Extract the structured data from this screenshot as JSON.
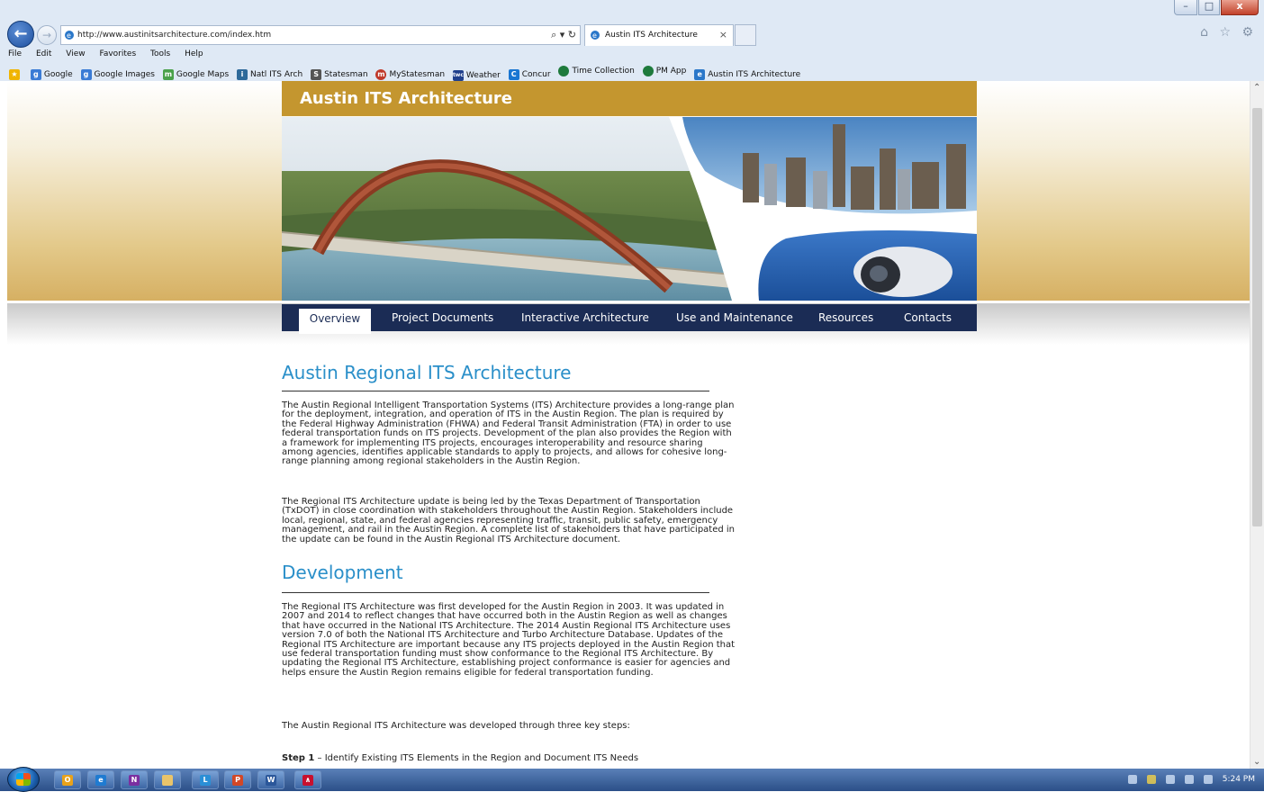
{
  "browser": {
    "address": "http://www.austinitsarchitecture.com/index.htm",
    "tab_title": "Austin ITS Architecture",
    "tab_close": "×",
    "search_tools": "⌕ ▾ ↻",
    "right_icons": "⌂ ☆ ⚙",
    "window_buttons": {
      "minimize": "–",
      "maximize": "□",
      "close": "x"
    },
    "menu": [
      "File",
      "Edit",
      "View",
      "Favorites",
      "Tools",
      "Help"
    ],
    "favorites": [
      {
        "label": "Google",
        "icon": "google-icon",
        "color": "#3a7bd5"
      },
      {
        "label": "Google Images",
        "icon": "google-icon",
        "color": "#3a7bd5"
      },
      {
        "label": "Google Maps",
        "icon": "maps-icon",
        "color": "#4aa14a"
      },
      {
        "label": "Natl ITS Arch",
        "icon": "its-icon",
        "color": "#2e6a9a"
      },
      {
        "label": "Statesman",
        "icon": "newspaper-icon",
        "color": "#555555"
      },
      {
        "label": "MyStatesman",
        "icon": "mystatesman-icon",
        "color": "#c0392b"
      },
      {
        "label": "Weather",
        "icon": "weather-icon",
        "color": "#1f3f8c"
      },
      {
        "label": "Concur",
        "icon": "concur-icon",
        "color": "#1976d2"
      },
      {
        "label": "Time Collection",
        "icon": "globe-icon",
        "color": "#1e7a3c"
      },
      {
        "label": "PM App",
        "icon": "globe-icon",
        "color": "#1e7a3c"
      },
      {
        "label": "Austin ITS Architecture",
        "icon": "ie-page-icon",
        "color": "#2a77c9"
      }
    ]
  },
  "site": {
    "title": "Austin ITS Architecture",
    "nav": [
      "Overview",
      "Project Documents",
      "Interactive Architecture",
      "Use and Maintenance",
      "Resources",
      "Contacts"
    ],
    "active_nav": "Overview"
  },
  "content": {
    "heading1": "Austin Regional ITS Architecture",
    "p1": "The Austin Regional Intelligent Transportation Systems (ITS) Architecture provides a long-range plan for the deployment, integration, and operation of ITS in the Austin Region. The plan is required by the Federal Highway Administration (FHWA) and Federal Transit Administration (FTA) in order to use federal transportation funds on ITS projects. Development of the plan also provides the Region with a framework for implementing ITS projects, encourages interoperability and resource sharing among agencies, identifies applicable standards to apply to projects, and allows for cohesive long-range planning among regional stakeholders in the Austin Region.",
    "p2": "The Regional ITS Architecture update is being led by the Texas Department of Transportation (TxDOT) in close coordination with stakeholders throughout the Austin Region. Stakeholders include local, regional, state, and federal agencies representing traffic, transit, public safety, emergency management, and rail in the Austin Region. A complete list of stakeholders that have participated in the update can be found in the Austin Regional ITS Architecture document.",
    "heading2": "Development",
    "p3": "The Regional ITS Architecture was first developed for the Austin Region in 2003. It was updated in 2007 and 2014 to reflect changes that have occurred both in the Austin Region as well as changes that have occurred in the National ITS Architecture. The 2014 Austin Regional ITS Architecture uses version 7.0 of both the National ITS Architecture and Turbo Architecture Database. Updates of the Regional ITS Architecture are important because any ITS projects deployed in the Austin Region that use federal transportation funding must show conformance to the Regional ITS Architecture. By updating the Regional ITS Architecture, establishing project conformance is easier for agencies and helps ensure the Austin Region remains eligible for federal transportation funding.",
    "p4": "The Austin Regional ITS Architecture was developed through three key steps:",
    "step1_label": "Step 1",
    "step1_text": " – Identify Existing ITS Elements in the Region and Document ITS Needs"
  },
  "taskbar": {
    "apps": [
      {
        "icon": "outlook-icon",
        "letter": "O",
        "color": "#e8a21a"
      },
      {
        "icon": "internet-explorer-icon",
        "letter": "e",
        "color": "#1f7bd1"
      },
      {
        "icon": "onenote-icon",
        "letter": "N",
        "color": "#7b2fa0"
      },
      {
        "icon": "file-explorer-icon",
        "letter": "",
        "color": "#e9c46a"
      },
      {
        "icon": "lync-icon",
        "letter": "L",
        "color": "#2a8fd6"
      },
      {
        "icon": "powerpoint-icon",
        "letter": "P",
        "color": "#d24726"
      },
      {
        "icon": "word-icon",
        "letter": "W",
        "color": "#2b579a"
      },
      {
        "icon": "acrobat-icon",
        "letter": "∧",
        "color": "#c8102e"
      }
    ],
    "clock": "5:24 PM"
  }
}
